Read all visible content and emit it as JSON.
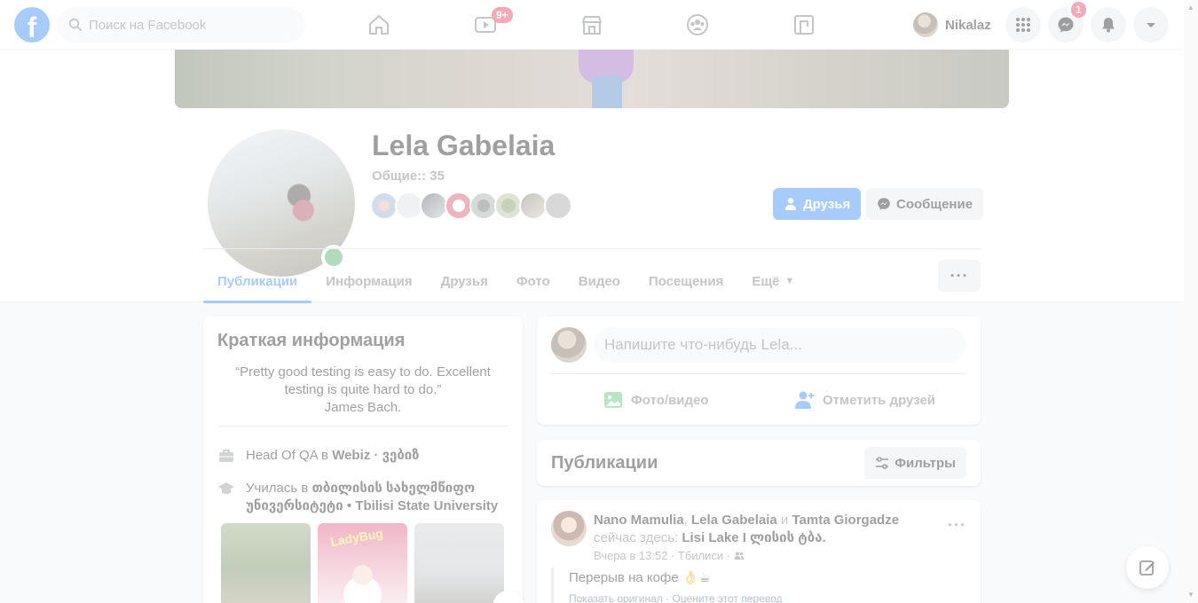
{
  "header": {
    "search_placeholder": "Поиск на Facebook",
    "watch_badge": "9+",
    "user_name": "Nikalaz",
    "messenger_badge": "1"
  },
  "profile": {
    "name": "Lela Gabelaia",
    "mutual": "Общие:: 35",
    "friends_button": "Друзья",
    "message_button": "Сообщение",
    "tabs": [
      "Публикации",
      "Информация",
      "Друзья",
      "Фото",
      "Видео",
      "Посещения",
      "Ещё"
    ],
    "more_dots": "···"
  },
  "intro": {
    "title": "Краткая информация",
    "bio_line1": "“Pretty good testing is easy to do. Excellent",
    "bio_line2": "testing is quite hard to do.”",
    "bio_line3": "James Bach.",
    "work_prefix": "Head Of QA в",
    "work_company": "Webiz · ვებიზ",
    "edu_prefix": "Училась в",
    "edu_line1": "თბილისის სახელმწიფო",
    "edu_line2": "უნივერსიტეტი • Tbilisi State University",
    "photo2_text": "LadyBug"
  },
  "composer": {
    "placeholder": "Напишите что-нибудь Lela...",
    "photo_video": "Фото/видео",
    "tag_friends": "Отметить друзей"
  },
  "posts_section": {
    "title": "Публикации",
    "filters": "Фильтры"
  },
  "post": {
    "author1": "Nano Mamulia",
    "comma": ",",
    "author2": "Lela Gabelaia",
    "and": "и",
    "author3": "Tamta Giorgadze",
    "now_here": "сейчас здесь:",
    "place": "Lisi Lake I ლისის ტბა.",
    "meta": "Вчера в 13:52 · Тбилиси ·",
    "text": "Перерыв на кофе 👌☕",
    "translate": "Показать оригинал · Оцените этот перевод"
  },
  "colors": {
    "brand": "#1877f2",
    "badge": "#e41e3f",
    "online": "#31a24c"
  },
  "icons": [
    "facebook-logo-icon",
    "search-icon",
    "home-icon",
    "watch-icon",
    "marketplace-icon",
    "groups-icon",
    "gaming-icon",
    "menu-grid-icon",
    "messenger-icon",
    "bell-icon",
    "caret-down-icon",
    "friends-icon",
    "messenger-small-icon",
    "briefcase-icon",
    "graduation-cap-icon",
    "photo-icon",
    "tag-friend-icon",
    "filter-icon",
    "friends-audience-icon",
    "compose-icon"
  ]
}
